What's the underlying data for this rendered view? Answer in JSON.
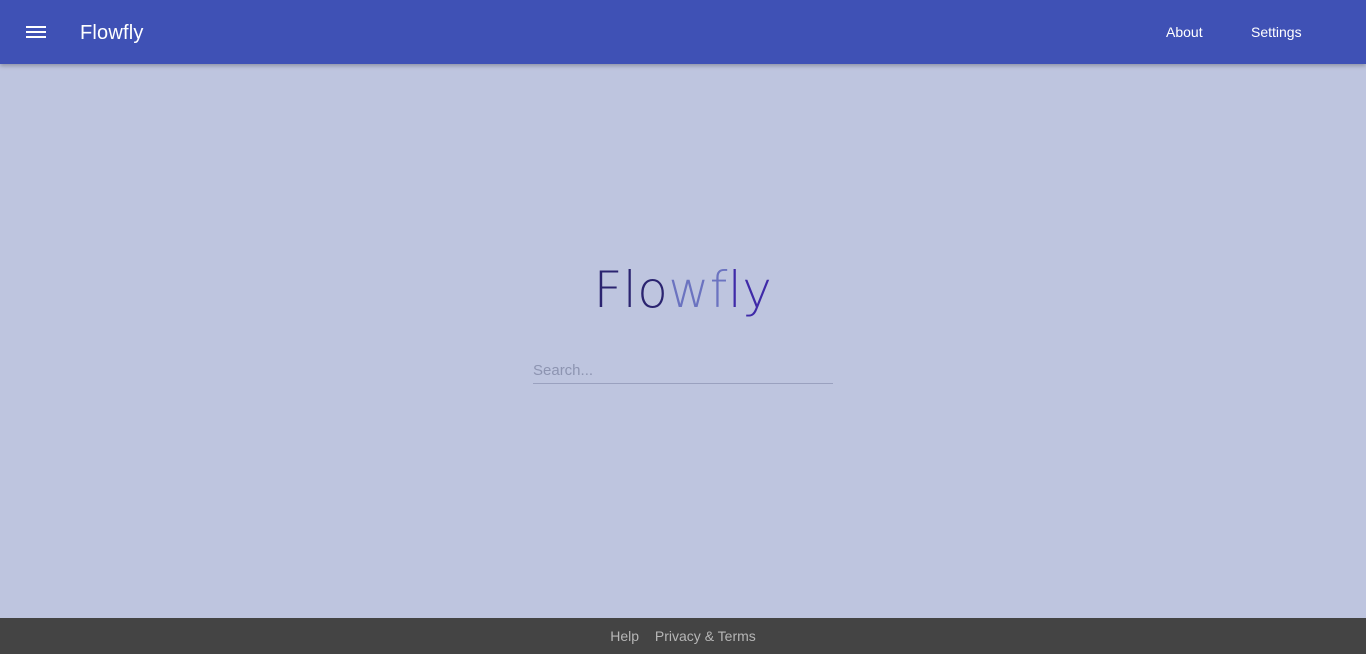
{
  "app": {
    "title": "Flowfly"
  },
  "header": {
    "menu_icon": "hamburger-menu-icon",
    "nav": [
      {
        "label": "About"
      },
      {
        "label": "Settings"
      }
    ]
  },
  "hero": {
    "brand_parts": [
      "Flo",
      "wf",
      "ly"
    ],
    "brand_colors": [
      "#2b2470",
      "#6b73c0",
      "#3f2aa8"
    ]
  },
  "search": {
    "placeholder": "Search...",
    "value": ""
  },
  "footer": {
    "links": [
      {
        "label": "Help"
      },
      {
        "label": "Privacy & Terms"
      }
    ]
  },
  "colors": {
    "appbar": "#3f51b5",
    "background": "#bec5df",
    "footer": "#444444"
  }
}
